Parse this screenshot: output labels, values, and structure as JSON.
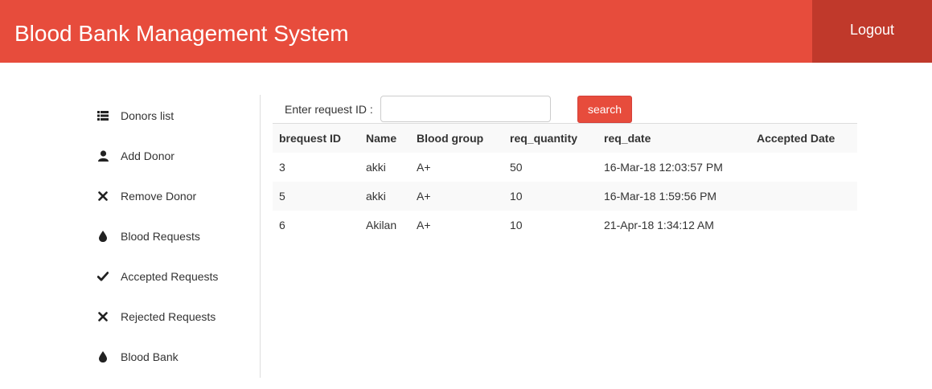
{
  "header": {
    "title": "Blood Bank Management System",
    "logout_label": "Logout",
    "colors": {
      "primary": "#e74c3c",
      "logout_bg": "#c0392b"
    }
  },
  "sidebar": {
    "items": [
      {
        "label": "Donors list",
        "icon": "list-icon"
      },
      {
        "label": "Add Donor",
        "icon": "user-icon"
      },
      {
        "label": "Remove Donor",
        "icon": "close-icon"
      },
      {
        "label": "Blood Requests",
        "icon": "drop-icon"
      },
      {
        "label": "Accepted Requests",
        "icon": "check-icon"
      },
      {
        "label": "Rejected Requests",
        "icon": "close-icon"
      },
      {
        "label": "Blood Bank",
        "icon": "drop-icon"
      }
    ]
  },
  "search": {
    "label": "Enter request ID :",
    "value": "",
    "placeholder": "",
    "button_label": "search"
  },
  "table": {
    "columns": [
      "brequest ID",
      "Name",
      "Blood group",
      "req_quantity",
      "req_date",
      "Accepted Date"
    ],
    "rows": [
      [
        "3",
        "akki",
        "A+",
        "50",
        "16-Mar-18 12:03:57 PM",
        ""
      ],
      [
        "5",
        "akki",
        "A+",
        "10",
        "16-Mar-18 1:59:56 PM",
        ""
      ],
      [
        "6",
        "Akilan",
        "A+",
        "10",
        "21-Apr-18 1:34:12 AM",
        ""
      ]
    ]
  }
}
